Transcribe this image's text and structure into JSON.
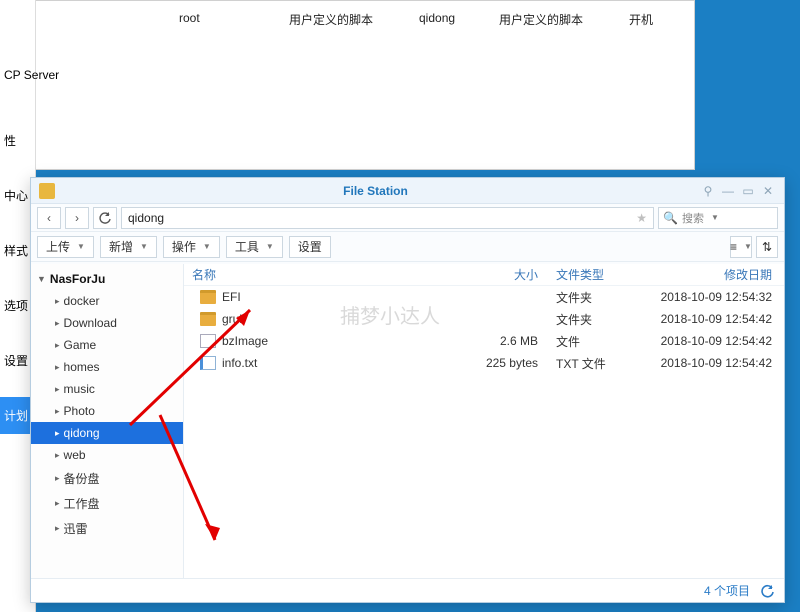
{
  "background": {
    "row": {
      "user": "root",
      "c2": "用户定义的脚本",
      "c3": "qidong",
      "c4": "用户定义的脚本",
      "c5": "开机"
    },
    "left_items": [
      "CP Server",
      "性",
      "中心",
      "样式",
      "选项",
      "设置",
      "计划"
    ],
    "left_selected": 6
  },
  "filestation": {
    "title": "File Station",
    "path": "qidong",
    "search_placeholder": "搜索",
    "toolbar": {
      "upload": "上传",
      "new": "新增",
      "ops": "操作",
      "tools": "工具",
      "settings": "设置"
    },
    "tree": {
      "root": "NasForJu",
      "items": [
        "docker",
        "Download",
        "Game",
        "homes",
        "music",
        "Photo",
        "qidong",
        "web",
        "备份盘",
        "工作盘",
        "迅雷"
      ],
      "selected": "qidong"
    },
    "columns": {
      "name": "名称",
      "size": "大小",
      "type": "文件类型",
      "date": "修改日期"
    },
    "files": [
      {
        "name": "EFI",
        "size": "",
        "type": "文件夹",
        "date": "2018-10-09 12:54:32",
        "icon": "folder"
      },
      {
        "name": "grub",
        "size": "",
        "type": "文件夹",
        "date": "2018-10-09 12:54:42",
        "icon": "folder"
      },
      {
        "name": "bzImage",
        "size": "2.6 MB",
        "type": "文件",
        "date": "2018-10-09 12:54:42",
        "icon": "file"
      },
      {
        "name": "info.txt",
        "size": "225 bytes",
        "type": "TXT 文件",
        "date": "2018-10-09 12:54:42",
        "icon": "txt"
      }
    ],
    "status": "4 个项目"
  },
  "watermark": "捕梦小达人"
}
